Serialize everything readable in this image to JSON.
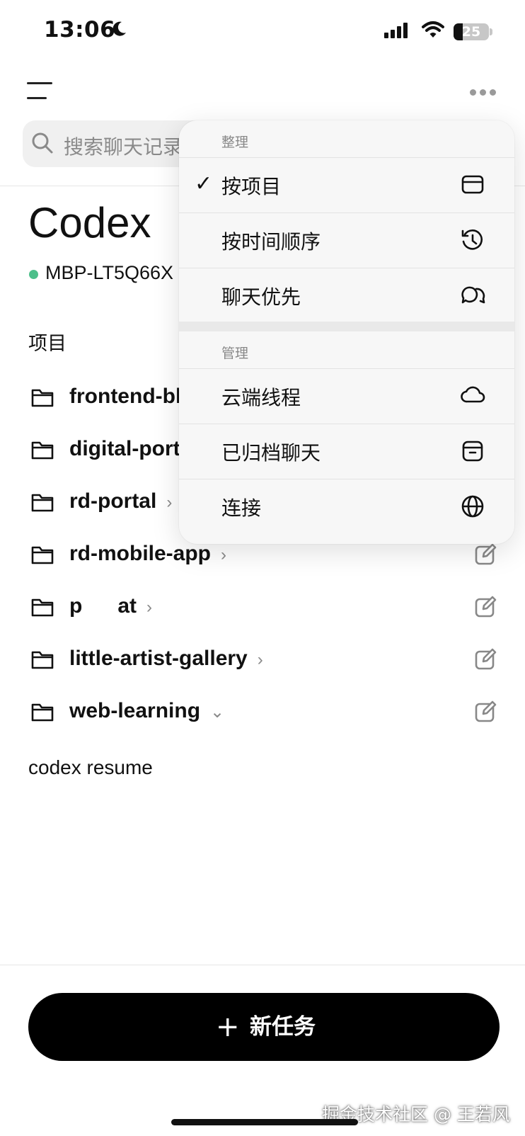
{
  "status_bar": {
    "time": "13:06",
    "battery": "25",
    "battery_level": 0.25
  },
  "search": {
    "placeholder": "搜索聊天记录"
  },
  "header": {
    "title": "Codex",
    "device": "MBP-LT5Q66X"
  },
  "projects_section": {
    "label": "项目"
  },
  "projects": [
    {
      "name": "frontend-blog",
      "chevron": "›"
    },
    {
      "name": "digital-portal",
      "chevron": "›"
    },
    {
      "name": "rd-portal",
      "chevron": "›"
    },
    {
      "name": "rd-mobile-app",
      "chevron": "›"
    },
    {
      "name": "p      at",
      "chevron": "›"
    },
    {
      "name": "little-artist-gallery",
      "chevron": "›"
    },
    {
      "name": "web-learning",
      "chevron": "⌄"
    }
  ],
  "resume_item": "codex resume",
  "new_task": {
    "plus": "+",
    "label": "新任务"
  },
  "watermark": "掘金技术社区 @ 王若风",
  "menu": {
    "group_organize": "整理",
    "check": "✓",
    "by_project": "按项目",
    "by_time": "按时间顺序",
    "chat_first": "聊天优先",
    "group_manage": "管理",
    "cloud_threads": "云端线程",
    "archived_chats": "已归档聊天",
    "connect": "连接"
  },
  "colors": {
    "status_dot": "#4cbf8a",
    "button_bg": "#000000"
  }
}
